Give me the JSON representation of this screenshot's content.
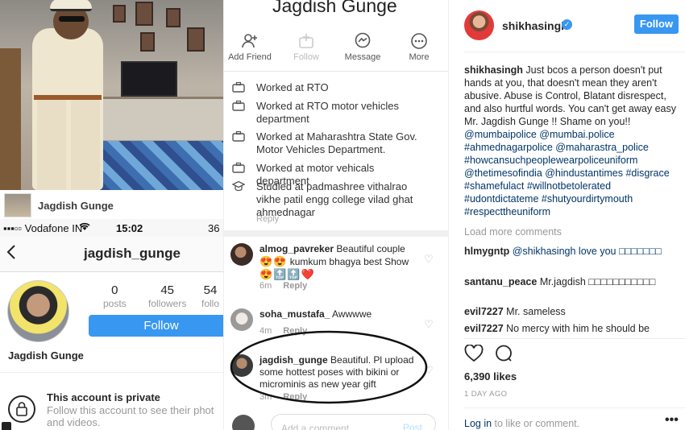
{
  "left": {
    "photo_caption_name": "Jagdish Gunge",
    "status_bar": {
      "carrier": "Vodafone IN",
      "time": "15:02",
      "battery": "36"
    },
    "profile": {
      "username": "jagdish_gunge",
      "posts": {
        "count": "0",
        "label": "posts"
      },
      "followers": {
        "count": "45",
        "label": "followers"
      },
      "following": {
        "count": "54",
        "label": "follo"
      },
      "follow_label": "Follow",
      "display_name": "Jagdish Gunge",
      "private_title": "This account is private",
      "private_sub_line1": "Follow this account to see their phot",
      "private_sub_line2": "and videos."
    }
  },
  "middle": {
    "fb_name": "Jagdish Gunge",
    "actions": [
      {
        "label": "Add Friend",
        "icon": "add-friend-icon"
      },
      {
        "label": "Follow",
        "icon": "follow-icon"
      },
      {
        "label": "Message",
        "icon": "messenger-icon"
      },
      {
        "label": "More",
        "icon": "more-icon"
      }
    ],
    "work": [
      {
        "text": "Worked at RTO",
        "icon": "briefcase-icon"
      },
      {
        "text": "Worked at RTO motor vehicles department",
        "icon": "briefcase-icon"
      },
      {
        "text": "Worked at Maharashtra State Gov. Motor Vehicles Department.",
        "icon": "briefcase-icon"
      },
      {
        "text": "Worked at motor vehicals department",
        "icon": "briefcase-icon"
      },
      {
        "text": "Studied at padmashree vithalrao vikhe patil engg college vilad ghat ahmednagar",
        "icon": "graduation-cap-icon"
      }
    ],
    "reply_cut": "Reply",
    "comments": [
      {
        "user": "almog_pavreker",
        "text": "Beautiful couple",
        "line2": "kumkum bhagya best Show",
        "emojis_line1": "😍😍",
        "emojis_line2": "😍🔝🔝❤️",
        "age": "6m",
        "reply": "Reply"
      },
      {
        "user": "soha_mustafa_",
        "text": "Awwwwe",
        "age": "4m",
        "reply": "Reply"
      },
      {
        "user": "jagdish_gunge",
        "text": "Beautiful. Pl upload some hottest poses with bikini or microminis as new year gift",
        "age": "3m",
        "reply": "Reply"
      }
    ],
    "add_comment_placeholder": "Add a comment...",
    "post_label": "Post"
  },
  "right": {
    "username": "shikhasingh",
    "follow_label": "Follow",
    "caption_user": "shikhasingh",
    "caption_text": "Just bcos a person doesn't put hands at you, that doesn't mean they aren't abusive. Abuse is Control, Blatant disrespect, and also hurtful words. You can't get away easy Mr. Jagdish Gunge !! Shame on you!!",
    "caption_tags": "@mumbaipolice @mumbai.police #ahmednagarpolice @maharastra_police #howcansuchpeoplewearpoliceuniform @thetimesofindia @hindustantimes #disgrace #shamefulact #willnotbetolerated #udontdictateme #shutyourdirtymouth #respecttheuniform",
    "load_more": "Load more comments",
    "comments": [
      {
        "user": "hlmygntp",
        "text": "@shikhasingh love you □□□□□□□"
      },
      {
        "user": "santanu_peace",
        "text": "Mr.jagdish □□□□□□□□□□□"
      },
      {
        "user": "evil7227",
        "text": "Mr. sameless"
      },
      {
        "user": "evil7227",
        "text": "No mercy with him he should be"
      }
    ],
    "likes": "6,390 likes",
    "age": "1 DAY AGO",
    "login_link": "Log in",
    "login_rest": " to like or comment.",
    "more_dots": "•••"
  },
  "colors": {
    "accent_blue": "#3897f0",
    "link_blue": "#003569",
    "muted_gray": "#999999"
  }
}
